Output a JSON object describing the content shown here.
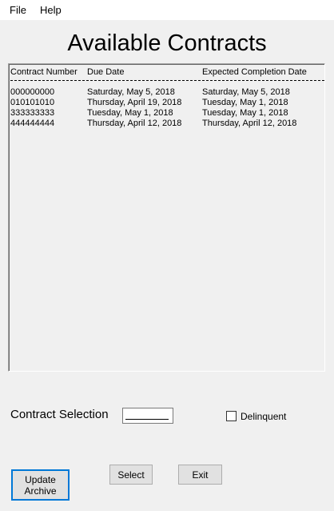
{
  "menu": {
    "file": "File",
    "help": "Help"
  },
  "title": "Available Contracts",
  "list": {
    "headers": {
      "contract_number": "Contract Number",
      "due_date": "Due Date",
      "expected_completion": "Expected Completion Date"
    },
    "rows": [
      {
        "contract_number": "000000000",
        "due_date": "Saturday, May 5, 2018",
        "expected_completion": "Saturday, May 5, 2018"
      },
      {
        "contract_number": "010101010",
        "due_date": "Thursday, April 19, 2018",
        "expected_completion": "Tuesday, May 1, 2018"
      },
      {
        "contract_number": "333333333",
        "due_date": "Tuesday, May 1, 2018",
        "expected_completion": "Tuesday, May 1, 2018"
      },
      {
        "contract_number": "444444444",
        "due_date": "Thursday, April 12, 2018",
        "expected_completion": "Thursday, April 12, 2018"
      }
    ]
  },
  "selection": {
    "label": "Contract Selection",
    "value": ""
  },
  "delinquent": {
    "label": "Delinquent",
    "checked": false
  },
  "buttons": {
    "update_archive": "Update Archive",
    "select": "Select",
    "exit": "Exit"
  }
}
